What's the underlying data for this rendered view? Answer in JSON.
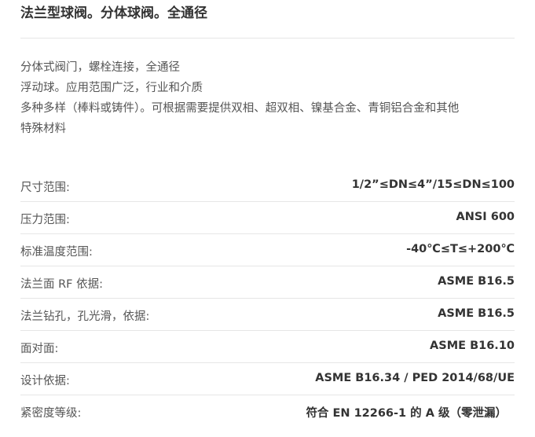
{
  "title": "法兰型球阀。分体球阀。全通径",
  "description": [
    "分体式阀门，螺栓连接，全通径",
    "浮动球。应用范围广泛，行业和介质",
    "多种多样（棒料或铸件）。可根据需要提供双相、超双相、镍基合金、青铜铝合金和其他",
    "特殊材料"
  ],
  "specs": [
    {
      "label": "尺寸范围:",
      "value": "1/2”≤DN≤4”/15≤DN≤100"
    },
    {
      "label": "压力范围:",
      "value": "ANSI 600"
    },
    {
      "label": "标准温度范围:",
      "value": "-40℃≤T≤+200℃"
    },
    {
      "label": "法兰面 RF 依据:",
      "value": "ASME B16.5"
    },
    {
      "label": "法兰钻孔，孔光滑，依据:",
      "value": "ASME B16.5"
    },
    {
      "label": "面对面:",
      "value": "ASME B16.10"
    },
    {
      "label": "设计依据:",
      "value": "ASME B16.34 / PED 2014/68/UE"
    },
    {
      "label": "紧密度等级:",
      "value": "符合 EN 12266-1 的 A 级（零泄漏）"
    }
  ]
}
